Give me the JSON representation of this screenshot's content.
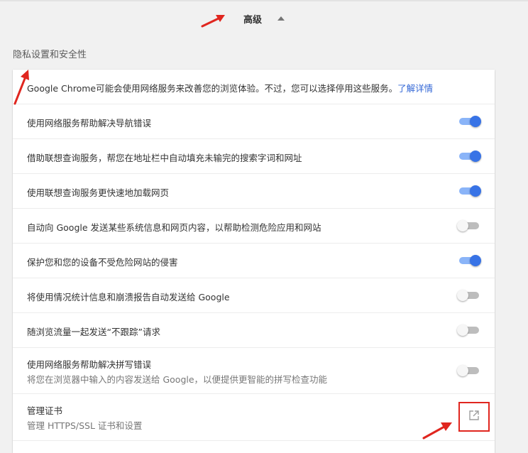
{
  "advanced": {
    "label": "高级",
    "caret_icon": "caret-up-icon"
  },
  "section": {
    "title": "隐私设置和安全性"
  },
  "info": {
    "text": "Google Chrome可能会使用网络服务来改善您的浏览体验。不过，您可以选择停用这些服务。",
    "link": "了解详情"
  },
  "settings": [
    {
      "label": "使用网络服务帮助解决导航错误",
      "enabled": true
    },
    {
      "label": "借助联想查询服务，帮您在地址栏中自动填充未输完的搜索字词和网址",
      "enabled": true
    },
    {
      "label": "使用联想查询服务更快速地加载网页",
      "enabled": true
    },
    {
      "label": "自动向 Google 发送某些系统信息和网页内容，以帮助检测危险应用和网站",
      "enabled": false
    },
    {
      "label": "保护您和您的设备不受危险网站的侵害",
      "enabled": true
    },
    {
      "label": "将使用情况统计信息和崩溃报告自动发送给 Google",
      "enabled": false
    },
    {
      "label": "随浏览流量一起发送“不跟踪”请求",
      "enabled": false
    },
    {
      "label": "使用网络服务帮助解决拼写错误",
      "sublabel": "将您在浏览器中输入的内容发送给 Google，以便提供更智能的拼写检查功能",
      "enabled": false
    }
  ],
  "certificates": {
    "title": "管理证书",
    "subtitle": "管理 HTTPS/SSL 证书和设置",
    "icon": "open-in-new-icon"
  },
  "colors": {
    "accent": "#3873e6",
    "link": "#3367d6",
    "annotation": "#e0261f"
  }
}
